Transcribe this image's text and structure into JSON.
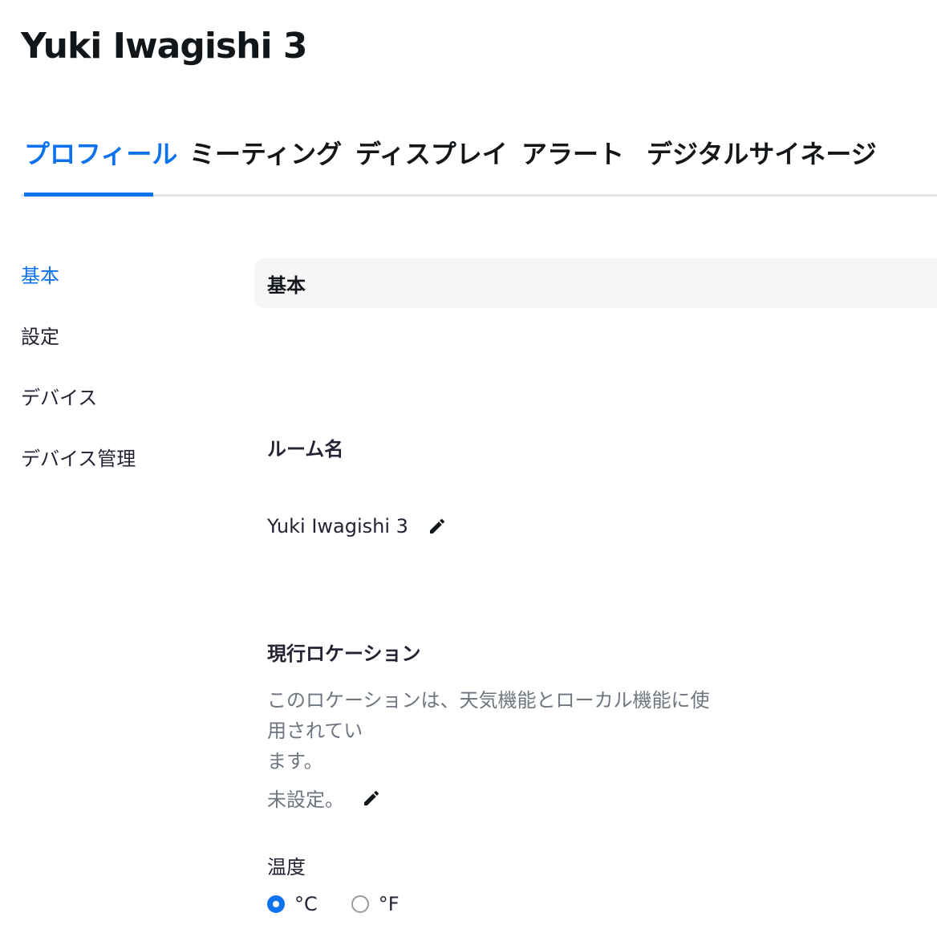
{
  "page": {
    "title": "Yuki Iwagishi 3"
  },
  "tabs": [
    {
      "label": "プロフィール",
      "active": true
    },
    {
      "label": "ミーティング",
      "active": false
    },
    {
      "label": "ディスプレイ",
      "active": false
    },
    {
      "label": "アラート",
      "active": false
    },
    {
      "label": "デジタルサイネージ",
      "active": false
    }
  ],
  "sidebar": {
    "items": [
      {
        "label": "基本",
        "active": true
      },
      {
        "label": "設定",
        "active": false
      },
      {
        "label": "デバイス",
        "active": false
      },
      {
        "label": "デバイス管理",
        "active": false
      }
    ]
  },
  "section": {
    "header": "基本"
  },
  "room_name": {
    "title": "ルーム名",
    "value": "Yuki Iwagishi 3",
    "edit_icon": "pencil-icon"
  },
  "location": {
    "title": "現行ロケーション",
    "description_line1": "このロケーションは、天気機能とローカル機能に使用されてい",
    "description_line2": "ます。",
    "value": "未設定。",
    "edit_icon": "pencil-icon"
  },
  "temperature": {
    "title": "温度",
    "options": [
      {
        "label": "°C",
        "selected": true
      },
      {
        "label": "°F",
        "selected": false
      }
    ]
  },
  "colors": {
    "accent": "#0e72ed",
    "text": "#232333",
    "muted": "#6e7680",
    "header_bg": "#f5f5f7",
    "divider": "#e4e4e7"
  }
}
